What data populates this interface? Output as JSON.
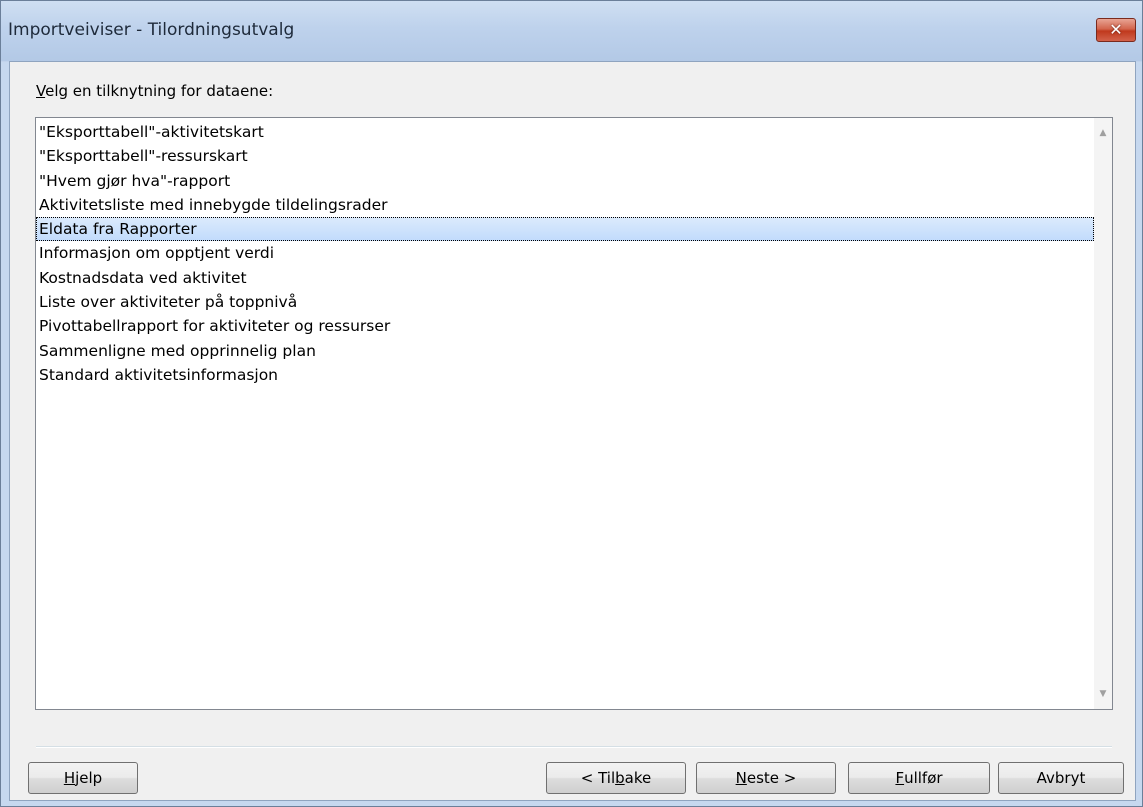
{
  "window": {
    "title": "Importveiviser - Tilordningsutvalg",
    "close_glyph": "✕"
  },
  "prompt": {
    "mnemonic": "V",
    "rest": "elg en tilknytning for dataene:"
  },
  "list": {
    "items": [
      "\"Eksporttabell\"-aktivitetskart",
      "\"Eksporttabell\"-ressurskart",
      "\"Hvem gjør hva\"-rapport",
      "Aktivitetsliste med innebygde tildelingsrader",
      "Eldata fra Rapporter",
      "Informasjon om opptjent verdi",
      "Kostnadsdata ved aktivitet",
      "Liste over aktiviteter på toppnivå",
      "Pivottabellrapport for aktiviteter og ressurser",
      "Sammenligne med opprinnelig plan",
      "Standard aktivitetsinformasjon"
    ],
    "selected_index": 4,
    "scroll_up_glyph": "▲",
    "scroll_down_glyph": "▼"
  },
  "buttons": {
    "help": {
      "mnemonic": "H",
      "rest": "jelp"
    },
    "back": {
      "before": "< Til",
      "mnemonic": "b",
      "rest": "ake"
    },
    "next": {
      "mnemonic": "N",
      "rest": "este >"
    },
    "finish": {
      "mnemonic": "F",
      "rest": "ullfør"
    },
    "cancel": {
      "label": "Avbryt"
    }
  },
  "icons": {
    "close": "close-icon",
    "scroll_up": "scroll-up-arrow-icon",
    "scroll_down": "scroll-down-arrow-icon"
  },
  "colors": {
    "selection": "#c1dbfc",
    "close_button": "#c0391d",
    "title_bar": "#bed2ec"
  }
}
